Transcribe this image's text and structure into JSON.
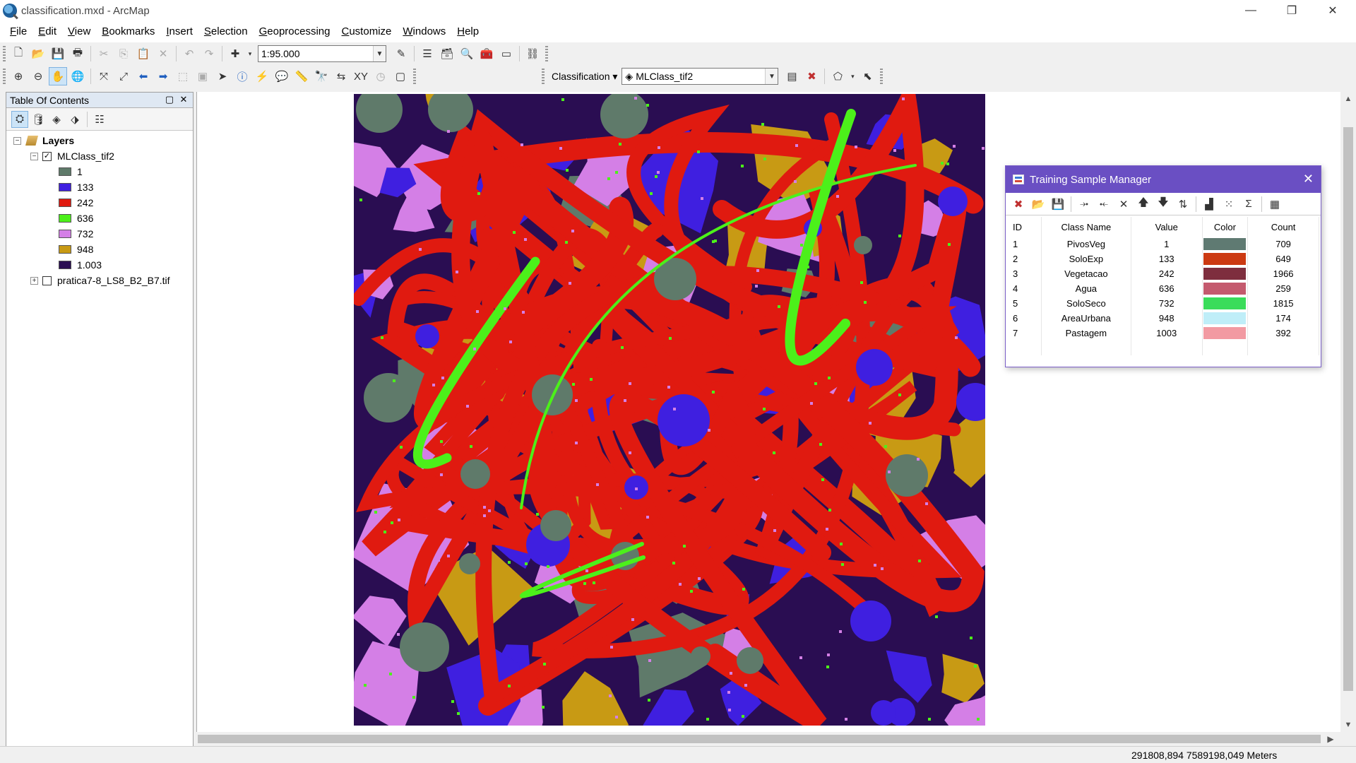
{
  "window": {
    "title": "classification.mxd - ArcMap",
    "controls": [
      "minimize",
      "restore",
      "close"
    ]
  },
  "menu": [
    {
      "label": "File",
      "key": "F"
    },
    {
      "label": "Edit",
      "key": "E"
    },
    {
      "label": "View",
      "key": "V"
    },
    {
      "label": "Bookmarks",
      "key": "B"
    },
    {
      "label": "Insert",
      "key": "I"
    },
    {
      "label": "Selection",
      "key": "S"
    },
    {
      "label": "Geoprocessing",
      "key": "G"
    },
    {
      "label": "Customize",
      "key": "C"
    },
    {
      "label": "Windows",
      "key": "W"
    },
    {
      "label": "Help",
      "key": "H"
    }
  ],
  "standard_toolbar": {
    "scale_value": "1:95.000"
  },
  "classification_toolbar": {
    "label": "Classification",
    "layer_value": "MLClass_tif2"
  },
  "toc": {
    "title": "Table Of Contents",
    "root_label": "Layers",
    "layer1": {
      "name": "MLClass_tif2",
      "checked": true,
      "classes": [
        {
          "label": "1",
          "color": "#5f7a6a"
        },
        {
          "label": "133",
          "color": "#3f1fe0"
        },
        {
          "label": "242",
          "color": "#e01a10"
        },
        {
          "label": "636",
          "color": "#4cf01a"
        },
        {
          "label": "732",
          "color": "#d47fe6"
        },
        {
          "label": "948",
          "color": "#c89a14"
        },
        {
          "label": "1.003",
          "color": "#2a0d52"
        }
      ]
    },
    "layer2": {
      "name": "pratica7-8_LS8_B2_B7.tif",
      "checked": false
    }
  },
  "training_sample_manager": {
    "title": "Training Sample Manager",
    "headers": {
      "id": "ID",
      "class_name": "Class Name",
      "value": "Value",
      "color": "Color",
      "count": "Count"
    },
    "rows": [
      {
        "id": "1",
        "class_name": "PivosVeg",
        "value": "1",
        "color": "#5f7a72",
        "count": "709"
      },
      {
        "id": "2",
        "class_name": "SoloExp",
        "value": "133",
        "color": "#cc3a12",
        "count": "649"
      },
      {
        "id": "3",
        "class_name": "Vegetacao",
        "value": "242",
        "color": "#7e2e3e",
        "count": "1966"
      },
      {
        "id": "4",
        "class_name": "Agua",
        "value": "636",
        "color": "#c45a6e",
        "count": "259"
      },
      {
        "id": "5",
        "class_name": "SoloSeco",
        "value": "732",
        "color": "#3adc5a",
        "count": "1815"
      },
      {
        "id": "6",
        "class_name": "AreaUrbana",
        "value": "948",
        "color": "#bfeef8",
        "count": "174"
      },
      {
        "id": "7",
        "class_name": "Pastagem",
        "value": "1003",
        "color": "#f29aa2",
        "count": "392"
      }
    ]
  },
  "status_bar": {
    "coordinates": "291808,894  7589198,049 Meters"
  }
}
